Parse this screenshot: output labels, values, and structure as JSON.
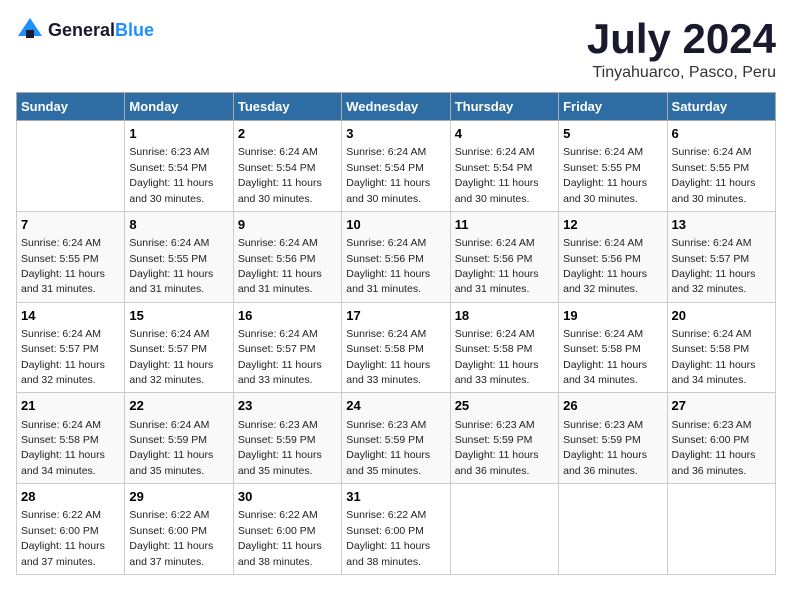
{
  "logo": {
    "text_general": "General",
    "text_blue": "Blue"
  },
  "title": "July 2024",
  "subtitle": "Tinyahuarco, Pasco, Peru",
  "headers": [
    "Sunday",
    "Monday",
    "Tuesday",
    "Wednesday",
    "Thursday",
    "Friday",
    "Saturday"
  ],
  "weeks": [
    [
      {
        "day": "",
        "sunrise": "",
        "sunset": "",
        "daylight": ""
      },
      {
        "day": "1",
        "sunrise": "Sunrise: 6:23 AM",
        "sunset": "Sunset: 5:54 PM",
        "daylight": "Daylight: 11 hours and 30 minutes."
      },
      {
        "day": "2",
        "sunrise": "Sunrise: 6:24 AM",
        "sunset": "Sunset: 5:54 PM",
        "daylight": "Daylight: 11 hours and 30 minutes."
      },
      {
        "day": "3",
        "sunrise": "Sunrise: 6:24 AM",
        "sunset": "Sunset: 5:54 PM",
        "daylight": "Daylight: 11 hours and 30 minutes."
      },
      {
        "day": "4",
        "sunrise": "Sunrise: 6:24 AM",
        "sunset": "Sunset: 5:54 PM",
        "daylight": "Daylight: 11 hours and 30 minutes."
      },
      {
        "day": "5",
        "sunrise": "Sunrise: 6:24 AM",
        "sunset": "Sunset: 5:55 PM",
        "daylight": "Daylight: 11 hours and 30 minutes."
      },
      {
        "day": "6",
        "sunrise": "Sunrise: 6:24 AM",
        "sunset": "Sunset: 5:55 PM",
        "daylight": "Daylight: 11 hours and 30 minutes."
      }
    ],
    [
      {
        "day": "7",
        "sunrise": "Sunrise: 6:24 AM",
        "sunset": "Sunset: 5:55 PM",
        "daylight": "Daylight: 11 hours and 31 minutes."
      },
      {
        "day": "8",
        "sunrise": "Sunrise: 6:24 AM",
        "sunset": "Sunset: 5:55 PM",
        "daylight": "Daylight: 11 hours and 31 minutes."
      },
      {
        "day": "9",
        "sunrise": "Sunrise: 6:24 AM",
        "sunset": "Sunset: 5:56 PM",
        "daylight": "Daylight: 11 hours and 31 minutes."
      },
      {
        "day": "10",
        "sunrise": "Sunrise: 6:24 AM",
        "sunset": "Sunset: 5:56 PM",
        "daylight": "Daylight: 11 hours and 31 minutes."
      },
      {
        "day": "11",
        "sunrise": "Sunrise: 6:24 AM",
        "sunset": "Sunset: 5:56 PM",
        "daylight": "Daylight: 11 hours and 31 minutes."
      },
      {
        "day": "12",
        "sunrise": "Sunrise: 6:24 AM",
        "sunset": "Sunset: 5:56 PM",
        "daylight": "Daylight: 11 hours and 32 minutes."
      },
      {
        "day": "13",
        "sunrise": "Sunrise: 6:24 AM",
        "sunset": "Sunset: 5:57 PM",
        "daylight": "Daylight: 11 hours and 32 minutes."
      }
    ],
    [
      {
        "day": "14",
        "sunrise": "Sunrise: 6:24 AM",
        "sunset": "Sunset: 5:57 PM",
        "daylight": "Daylight: 11 hours and 32 minutes."
      },
      {
        "day": "15",
        "sunrise": "Sunrise: 6:24 AM",
        "sunset": "Sunset: 5:57 PM",
        "daylight": "Daylight: 11 hours and 32 minutes."
      },
      {
        "day": "16",
        "sunrise": "Sunrise: 6:24 AM",
        "sunset": "Sunset: 5:57 PM",
        "daylight": "Daylight: 11 hours and 33 minutes."
      },
      {
        "day": "17",
        "sunrise": "Sunrise: 6:24 AM",
        "sunset": "Sunset: 5:58 PM",
        "daylight": "Daylight: 11 hours and 33 minutes."
      },
      {
        "day": "18",
        "sunrise": "Sunrise: 6:24 AM",
        "sunset": "Sunset: 5:58 PM",
        "daylight": "Daylight: 11 hours and 33 minutes."
      },
      {
        "day": "19",
        "sunrise": "Sunrise: 6:24 AM",
        "sunset": "Sunset: 5:58 PM",
        "daylight": "Daylight: 11 hours and 34 minutes."
      },
      {
        "day": "20",
        "sunrise": "Sunrise: 6:24 AM",
        "sunset": "Sunset: 5:58 PM",
        "daylight": "Daylight: 11 hours and 34 minutes."
      }
    ],
    [
      {
        "day": "21",
        "sunrise": "Sunrise: 6:24 AM",
        "sunset": "Sunset: 5:58 PM",
        "daylight": "Daylight: 11 hours and 34 minutes."
      },
      {
        "day": "22",
        "sunrise": "Sunrise: 6:24 AM",
        "sunset": "Sunset: 5:59 PM",
        "daylight": "Daylight: 11 hours and 35 minutes."
      },
      {
        "day": "23",
        "sunrise": "Sunrise: 6:23 AM",
        "sunset": "Sunset: 5:59 PM",
        "daylight": "Daylight: 11 hours and 35 minutes."
      },
      {
        "day": "24",
        "sunrise": "Sunrise: 6:23 AM",
        "sunset": "Sunset: 5:59 PM",
        "daylight": "Daylight: 11 hours and 35 minutes."
      },
      {
        "day": "25",
        "sunrise": "Sunrise: 6:23 AM",
        "sunset": "Sunset: 5:59 PM",
        "daylight": "Daylight: 11 hours and 36 minutes."
      },
      {
        "day": "26",
        "sunrise": "Sunrise: 6:23 AM",
        "sunset": "Sunset: 5:59 PM",
        "daylight": "Daylight: 11 hours and 36 minutes."
      },
      {
        "day": "27",
        "sunrise": "Sunrise: 6:23 AM",
        "sunset": "Sunset: 6:00 PM",
        "daylight": "Daylight: 11 hours and 36 minutes."
      }
    ],
    [
      {
        "day": "28",
        "sunrise": "Sunrise: 6:22 AM",
        "sunset": "Sunset: 6:00 PM",
        "daylight": "Daylight: 11 hours and 37 minutes."
      },
      {
        "day": "29",
        "sunrise": "Sunrise: 6:22 AM",
        "sunset": "Sunset: 6:00 PM",
        "daylight": "Daylight: 11 hours and 37 minutes."
      },
      {
        "day": "30",
        "sunrise": "Sunrise: 6:22 AM",
        "sunset": "Sunset: 6:00 PM",
        "daylight": "Daylight: 11 hours and 38 minutes."
      },
      {
        "day": "31",
        "sunrise": "Sunrise: 6:22 AM",
        "sunset": "Sunset: 6:00 PM",
        "daylight": "Daylight: 11 hours and 38 minutes."
      },
      {
        "day": "",
        "sunrise": "",
        "sunset": "",
        "daylight": ""
      },
      {
        "day": "",
        "sunrise": "",
        "sunset": "",
        "daylight": ""
      },
      {
        "day": "",
        "sunrise": "",
        "sunset": "",
        "daylight": ""
      }
    ]
  ]
}
